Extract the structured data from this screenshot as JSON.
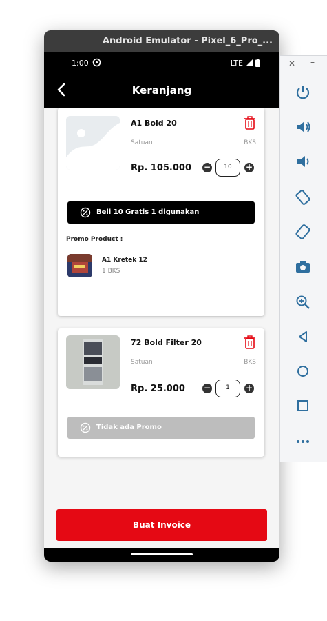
{
  "window": {
    "title": "Android Emulator - Pixel_6_Pro_..."
  },
  "status_bar": {
    "time": "1:00",
    "network": "LTE"
  },
  "app_bar": {
    "title": "Keranjang"
  },
  "cart": [
    {
      "name": "A1 Bold 20",
      "unit_label": "Satuan",
      "unit_value": "BKS",
      "price": "Rp. 105.000",
      "quantity": "10",
      "promo_button": "Beli 10 Gratis 1 digunakan",
      "promo_heading": "Promo Product :",
      "promo_item": {
        "name": "A1 Kretek 12",
        "qty": "1 BKS"
      }
    },
    {
      "name": "72 Bold Filter 20",
      "unit_label": "Satuan",
      "unit_value": "BKS",
      "price": "Rp. 25.000",
      "quantity": "1",
      "promo_button": "Tidak ada Promo"
    }
  ],
  "footer": {
    "invoice_button": "Buat Invoice"
  },
  "colors": {
    "accent": "#e50914",
    "appbar": "#000000",
    "promo_active": "#000000",
    "promo_inactive": "#bdbdbd"
  },
  "toolbar_icons": [
    "close-icon",
    "minimize-icon",
    "power-icon",
    "volume-up-icon",
    "volume-down-icon",
    "rotate-left-icon",
    "rotate-right-icon",
    "camera-icon",
    "zoom-icon",
    "back-icon",
    "home-icon",
    "overview-icon",
    "more-icon"
  ]
}
